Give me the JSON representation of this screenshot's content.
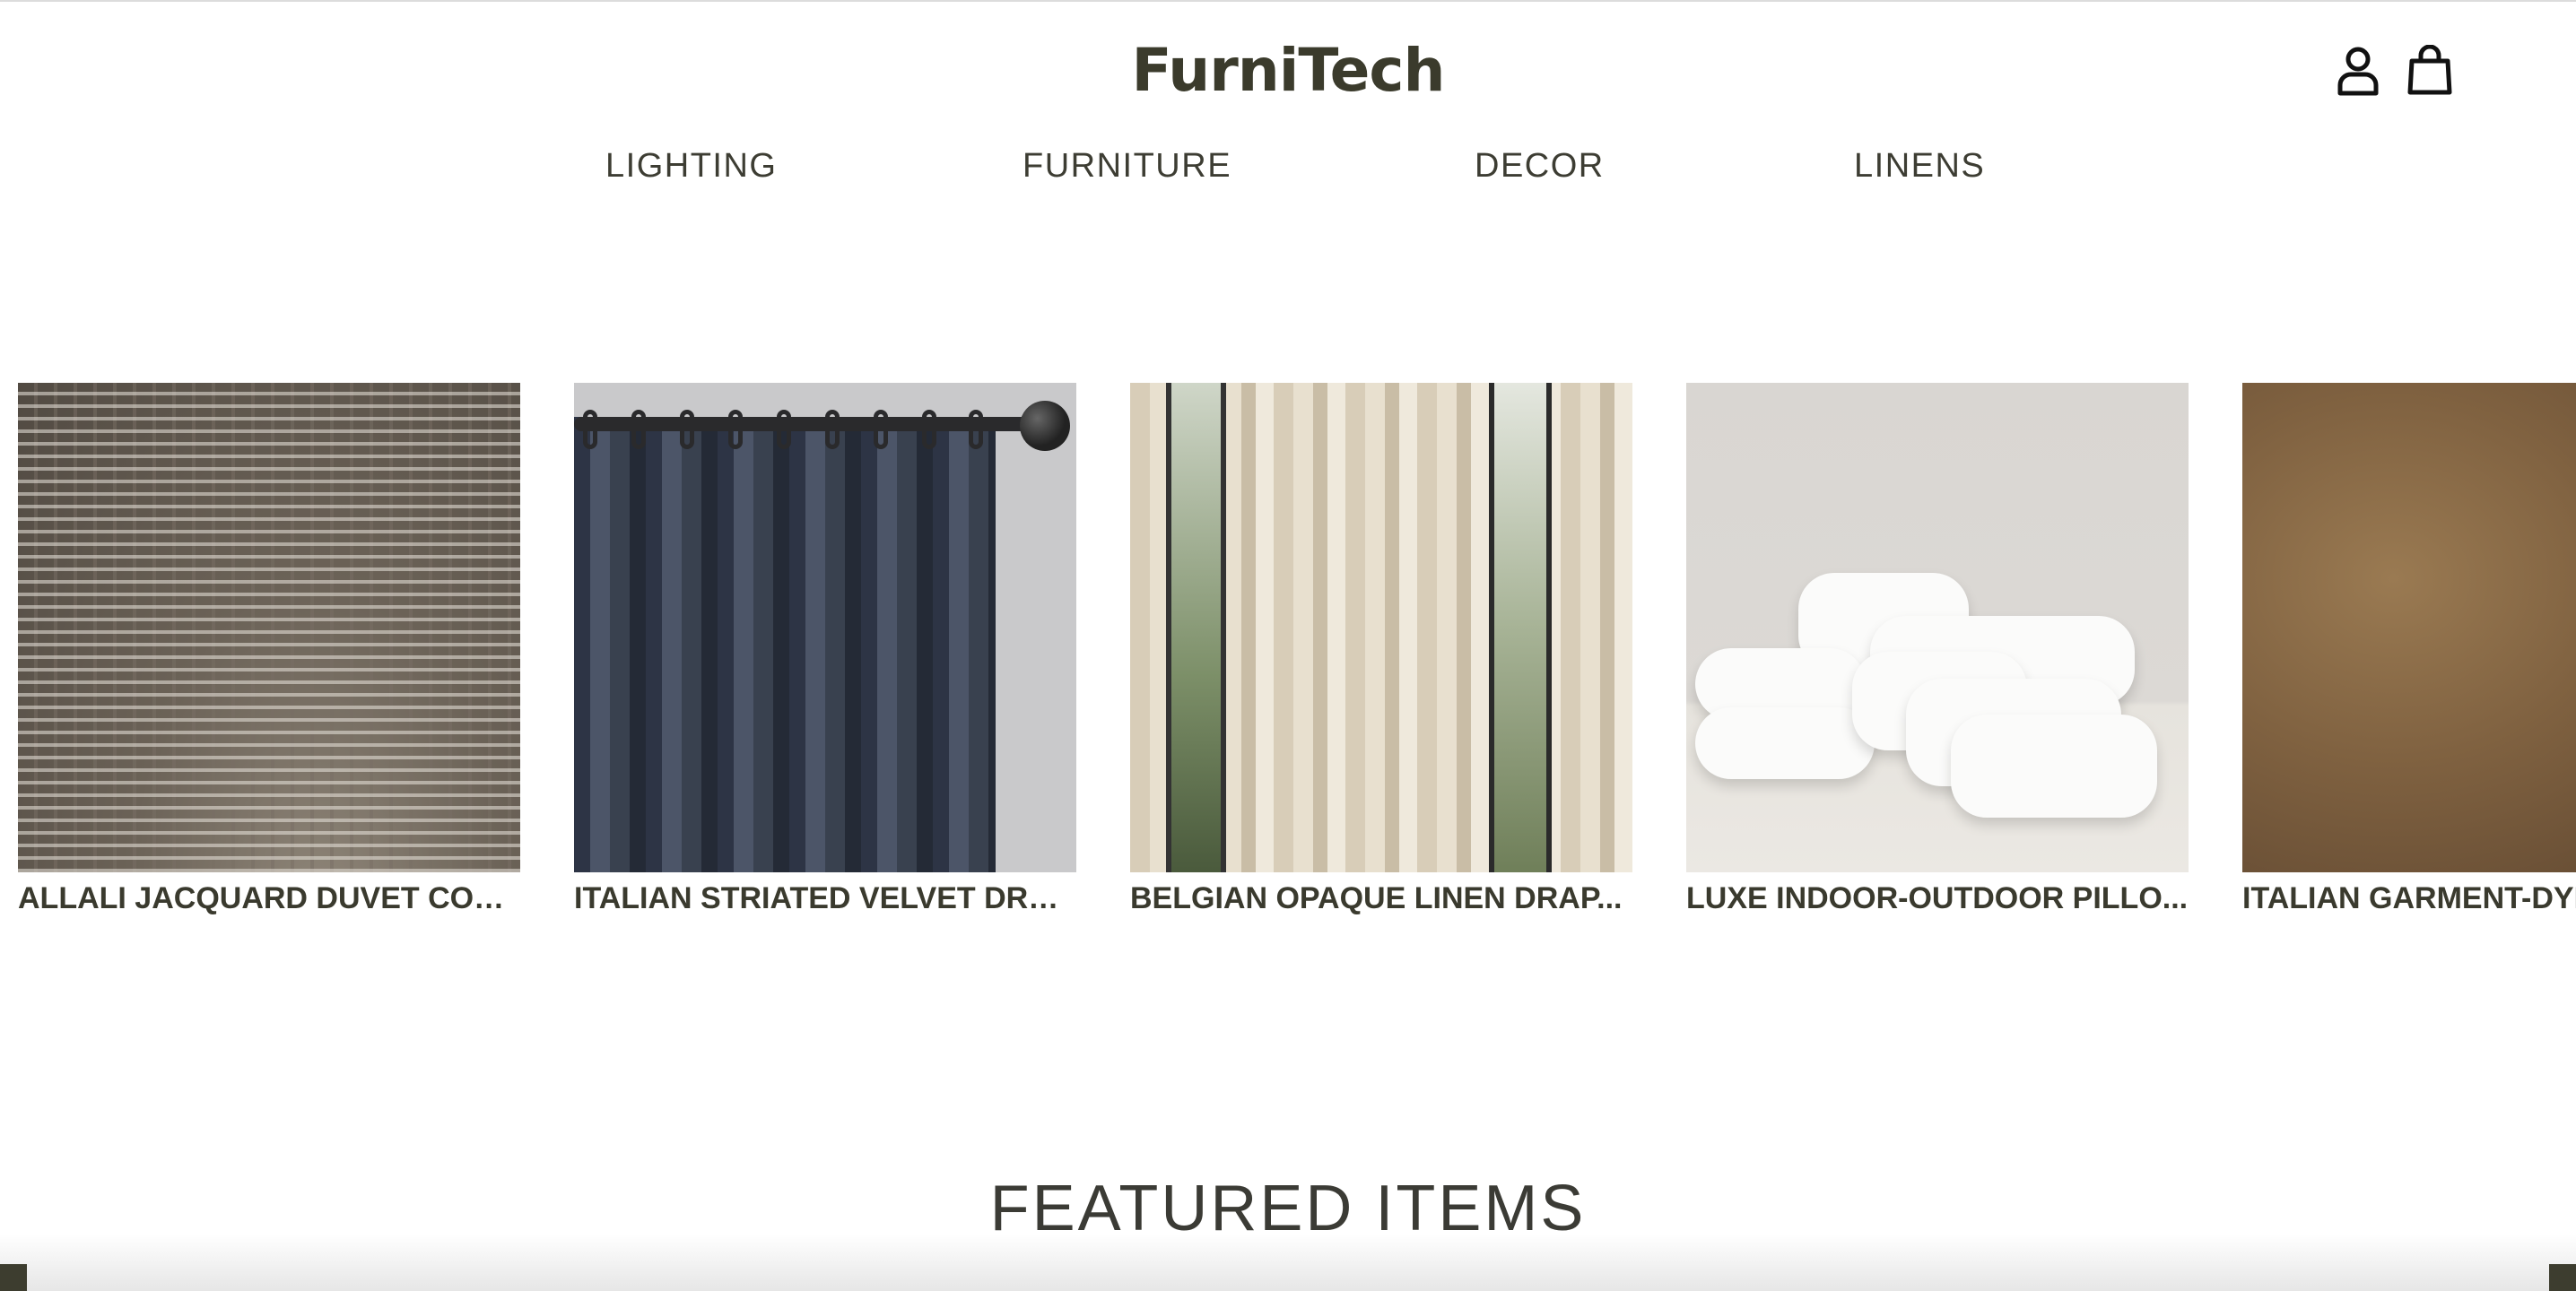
{
  "header": {
    "brand": "FurniTech",
    "icons": [
      "user-icon",
      "shopping-bag-icon"
    ]
  },
  "nav": {
    "items": [
      {
        "label": "LIGHTING"
      },
      {
        "label": "FURNITURE"
      },
      {
        "label": "DECOR"
      },
      {
        "label": "LINENS"
      }
    ]
  },
  "carousel": {
    "products": [
      {
        "title": "ALLALI JACQUARD DUVET COVER"
      },
      {
        "title": "ITALIAN STRIATED VELVET DRAP..."
      },
      {
        "title": "BELGIAN OPAQUE LINEN DRAP..."
      },
      {
        "title": "LUXE INDOOR-OUTDOOR PILLO..."
      },
      {
        "title": "ITALIAN GARMENT-DYE"
      }
    ]
  },
  "sections": {
    "featured_title": "FEATURED ITEMS"
  },
  "colors": {
    "brand_text": "#3b3b2c",
    "nav_text": "#3d3d33",
    "title_text": "#3a3a2e",
    "background": "#ffffff"
  }
}
